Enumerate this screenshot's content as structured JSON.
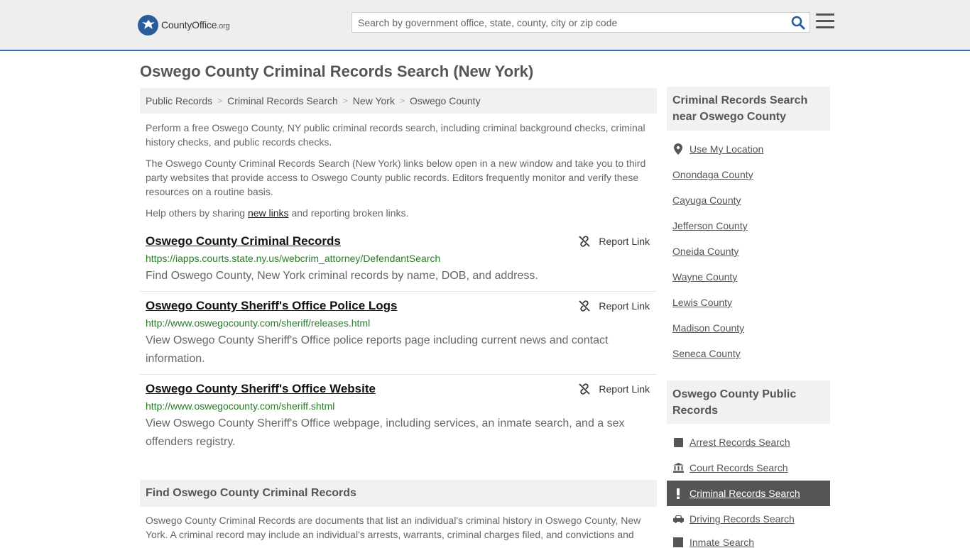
{
  "header": {
    "logo_main": "County",
    "logo_bold": "Office",
    "logo_tld": ".org",
    "search_placeholder": "Search by government office, state, county, city or zip code"
  },
  "page_title": "Oswego County Criminal Records Search (New York)",
  "breadcrumb": [
    "Public Records",
    "Criminal Records Search",
    "New York",
    "Oswego County"
  ],
  "intro": {
    "p1": "Perform a free Oswego County, NY public criminal records search, including criminal background checks, criminal history checks, and public records checks.",
    "p2": "The Oswego County Criminal Records Search (New York) links below open in a new window and take you to third party websites that provide access to Oswego County public records. Editors frequently monitor and verify these resources on a routine basis.",
    "p3_before": "Help others by sharing ",
    "p3_link": "new links",
    "p3_after": " and reporting broken links."
  },
  "report_label": "Report Link",
  "records": [
    {
      "title": "Oswego County Criminal Records",
      "url": "https://iapps.courts.state.ny.us/webcrim_attorney/DefendantSearch",
      "desc": "Find Oswego County, New York criminal records by name, DOB, and address."
    },
    {
      "title": "Oswego County Sheriff's Office Police Logs",
      "url": "http://www.oswegocounty.com/sheriff/releases.html",
      "desc": "View Oswego County Sheriff's Office police reports page including current news and contact information."
    },
    {
      "title": "Oswego County Sheriff's Office Website",
      "url": "http://www.oswegocounty.com/sheriff.shtml",
      "desc": "View Oswego County Sheriff's Office webpage, including services, an inmate search, and a sex offenders registry."
    }
  ],
  "find_section": {
    "title": "Find Oswego County Criminal Records",
    "text": "Oswego County Criminal Records are documents that list an individual's criminal history in Oswego County, New York. A criminal record may include an individual's arrests, warrants, criminal charges filed, and convictions and"
  },
  "sidebar": {
    "nearby_title": "Criminal Records Search near Oswego County",
    "use_location": "Use My Location",
    "nearby": [
      "Onondaga County",
      "Cayuga County",
      "Jefferson County",
      "Oneida County",
      "Wayne County",
      "Lewis County",
      "Madison County",
      "Seneca County"
    ],
    "public_title": "Oswego County Public Records",
    "public_links": [
      "Arrest Records Search",
      "Court Records Search",
      "Criminal Records Search",
      "Driving Records Search",
      "Inmate Search"
    ]
  },
  "colors": {
    "accent": "#3a6fb0",
    "url_green": "#2a7a2a",
    "active_bg": "#555555"
  }
}
